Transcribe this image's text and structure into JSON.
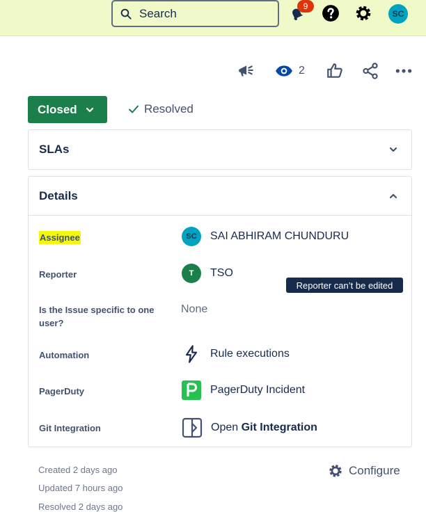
{
  "topbar": {
    "search_placeholder": "Search",
    "notification_count": "9",
    "avatar_initials": "SC"
  },
  "actions": {
    "watch_count": "2"
  },
  "status": {
    "button_label": "Closed",
    "resolution_label": "Resolved"
  },
  "panels": {
    "slas_title": "SLAs",
    "details_title": "Details"
  },
  "fields": {
    "assignee_label": "Assignee",
    "assignee_initials": "SC",
    "assignee_value": "SAI ABHIRAM CHUNDURU",
    "reporter_label": "Reporter",
    "reporter_initial": "T",
    "reporter_value": "TSO",
    "reporter_tooltip": "Reporter can’t be edited",
    "specific_label": "Is the Issue specific to one user?",
    "specific_value": "None",
    "automation_label": "Automation",
    "automation_value": "Rule executions",
    "pagerduty_label": "PagerDuty",
    "pagerduty_value": "PagerDuty Incident",
    "git_label": "Git Integration",
    "git_value_prefix": "Open",
    "git_value_bold": "Git Integration"
  },
  "footer": {
    "created": "Created 2 days ago",
    "updated": "Updated 7 hours ago",
    "resolved": "Resolved 2 days ago",
    "configure_label": "Configure"
  },
  "colors": {
    "topbar_bg": "#f0f9c8",
    "status_green": "#1a7f4b",
    "avatar_teal": "#00a3bf",
    "badge_red": "#de350b",
    "highlight": "#f4f710",
    "pagerduty_green": "#25c151"
  }
}
